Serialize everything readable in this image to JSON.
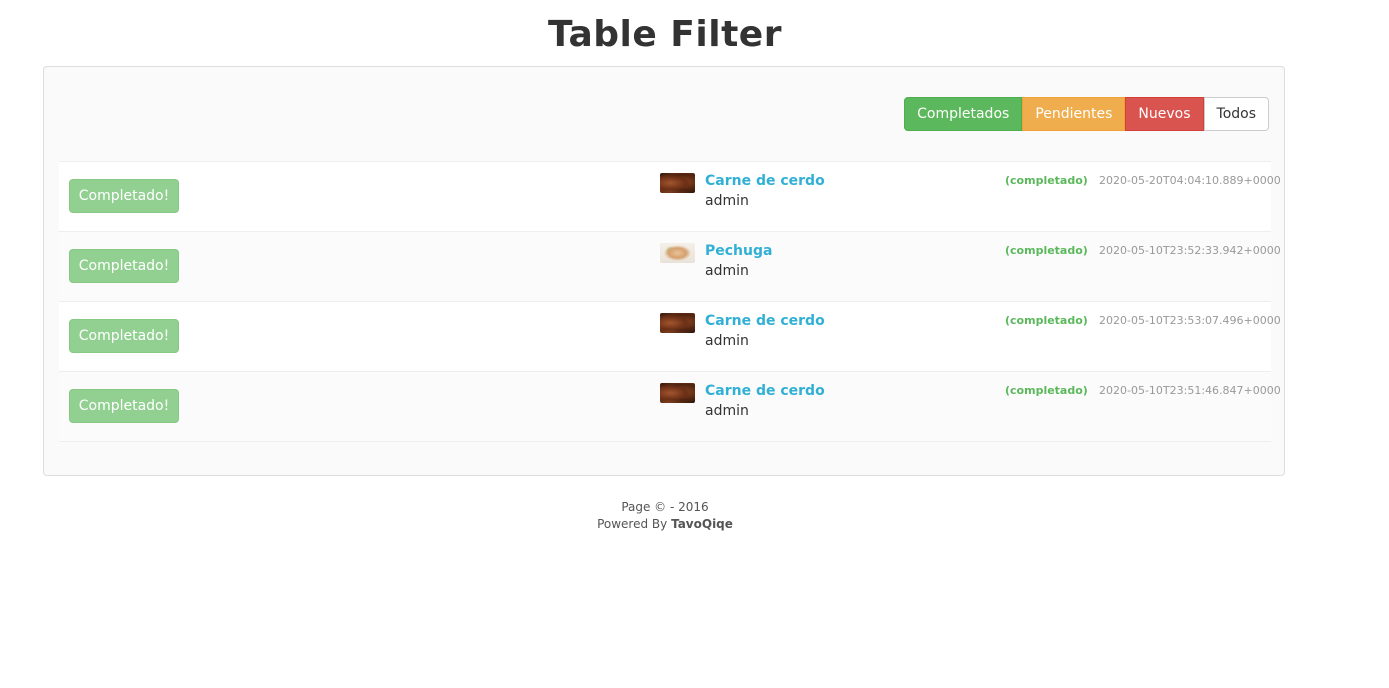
{
  "page": {
    "title": "Table Filter"
  },
  "filters": [
    {
      "label": "Completados",
      "style": "success",
      "color": "#5cb85c"
    },
    {
      "label": "Pendientes",
      "style": "warning",
      "color": "#f0ad4e"
    },
    {
      "label": "Nuevos",
      "style": "danger",
      "color": "#d9534f"
    },
    {
      "label": "Todos",
      "style": "default",
      "color": "#ffffff"
    }
  ],
  "rows": [
    {
      "button": "Completado!",
      "thumb_icon": "meat-photo",
      "name": "Carne de cerdo",
      "user": "admin",
      "status": "(completado)",
      "date": "2020-05-20T04:04:10.889+0000"
    },
    {
      "button": "Completado!",
      "thumb_icon": "chicken-photo",
      "name": "Pechuga",
      "user": "admin",
      "status": "(completado)",
      "date": "2020-05-10T23:52:33.942+0000"
    },
    {
      "button": "Completado!",
      "thumb_icon": "meat-photo",
      "name": "Carne de cerdo",
      "user": "admin",
      "status": "(completado)",
      "date": "2020-05-10T23:53:07.496+0000"
    },
    {
      "button": "Completado!",
      "thumb_icon": "meat-photo",
      "name": "Carne de cerdo",
      "user": "admin",
      "status": "(completado)",
      "date": "2020-05-10T23:51:46.847+0000"
    }
  ],
  "footer": {
    "copyright": "Page © - 2016",
    "powered_prefix": "Powered By ",
    "powered_name": "TavoQiqe"
  }
}
